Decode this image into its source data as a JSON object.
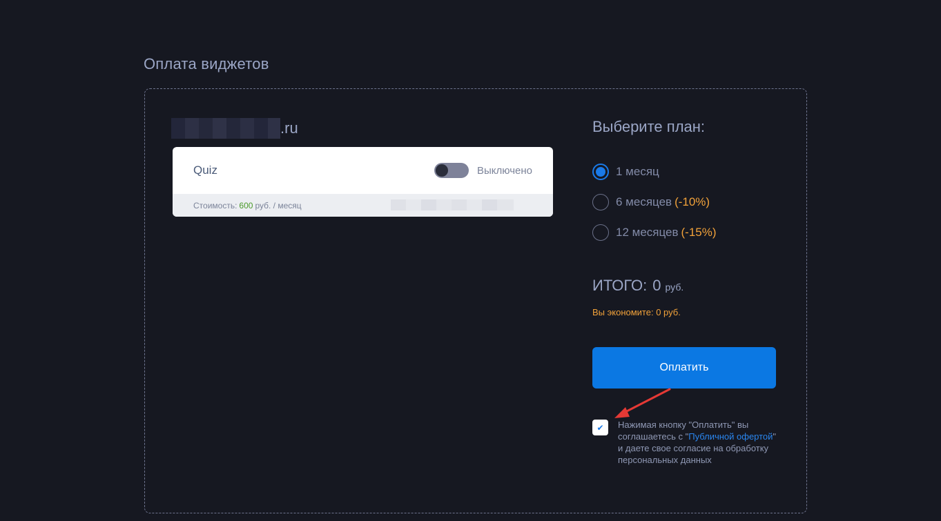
{
  "page": {
    "title": "Оплата виджетов"
  },
  "site": {
    "domain_suffix": ".ru"
  },
  "widget": {
    "name": "Quiz",
    "toggle_label": "Выключено",
    "toggle_on": false,
    "cost_label": "Стоимость:",
    "cost_value": "600",
    "cost_unit": "руб. / месяц"
  },
  "plans": {
    "title": "Выберите план:",
    "options": [
      {
        "label": "1 месяц",
        "discount": "",
        "selected": true
      },
      {
        "label": "6 месяцев",
        "discount": "(-10%)",
        "selected": false
      },
      {
        "label": "12 месяцев",
        "discount": "(-15%)",
        "selected": false
      }
    ]
  },
  "summary": {
    "total_label": "ИТОГО:",
    "total_value": "0",
    "total_currency": "руб.",
    "saving_text": "Вы экономите: 0 руб."
  },
  "pay": {
    "button_label": "Оплатить"
  },
  "consent": {
    "checked": true,
    "check_glyph": "✔",
    "text_before": "Нажимая кнопку \"Оплатить\" вы соглашаетесь с \"",
    "link_text": "Публичной офертой",
    "text_after": "\" и даете свое согласие на обработку персональных данных"
  },
  "colors": {
    "background": "#161821",
    "accent": "#0b78e3",
    "discount": "#f2a23a",
    "price": "#4a9a2a",
    "annotation_arrow": "#e53935"
  },
  "icons": {
    "annotation": "red-arrow-icon",
    "check": "check-icon"
  }
}
